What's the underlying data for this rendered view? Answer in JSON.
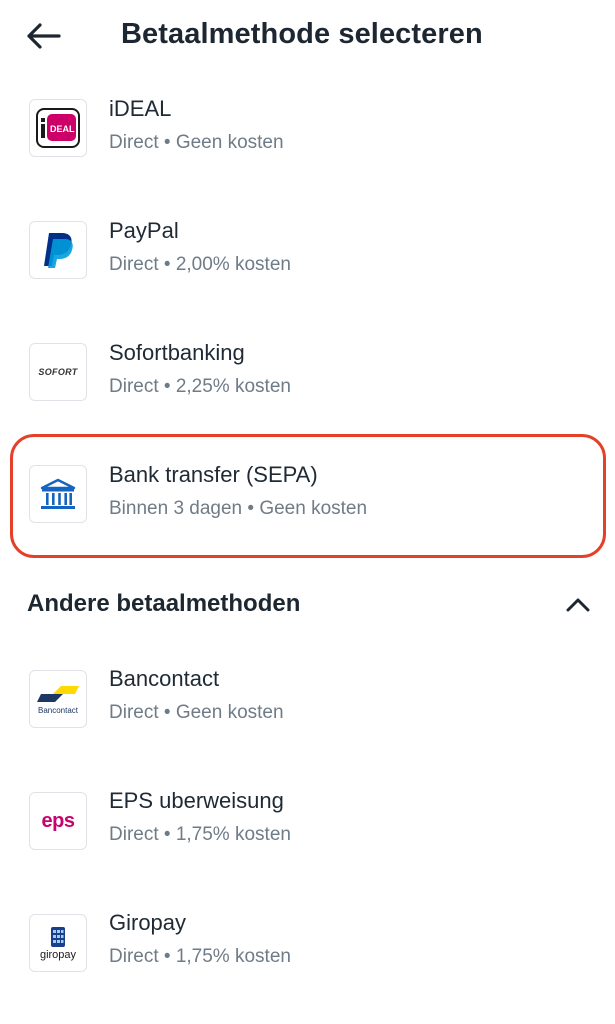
{
  "header": {
    "title": "Betaalmethode selecteren",
    "back_icon": "arrow-left-icon"
  },
  "methods": [
    {
      "name": "iDEAL",
      "detail": "Direct • Geen kosten",
      "logo": "ideal-logo",
      "logo_text": "iDEAL"
    },
    {
      "name": "PayPal",
      "detail": "Direct • 2,00% kosten",
      "logo": "paypal-logo"
    },
    {
      "name": "Sofortbanking",
      "detail": "Direct • 2,25% kosten",
      "logo": "sofort-logo",
      "logo_text": "SOFORT"
    },
    {
      "name": "Bank transfer (SEPA)",
      "detail": "Binnen 3 dagen • Geen kosten",
      "logo": "bank-icon",
      "highlighted": true
    }
  ],
  "other_section": {
    "title": "Andere betaalmethoden",
    "toggle_icon": "chevron-up-icon",
    "methods": [
      {
        "name": "Bancontact",
        "detail": "Direct • Geen kosten",
        "logo": "bancontact-logo",
        "logo_text": "Bancontact"
      },
      {
        "name": "EPS uberweisung",
        "detail": "Direct • 1,75% kosten",
        "logo": "eps-logo",
        "logo_text": "eps"
      },
      {
        "name": "Giropay",
        "detail": "Direct • 1,75% kosten",
        "logo": "giropay-logo",
        "logo_text": "giropay"
      }
    ]
  },
  "colors": {
    "highlight": "#e5402a",
    "ideal": "#cc0066",
    "paypal_dark": "#003087",
    "paypal_light": "#009cde",
    "bank_blue": "#1565c0",
    "text": "#1f2a35",
    "muted": "#6f7b86"
  }
}
